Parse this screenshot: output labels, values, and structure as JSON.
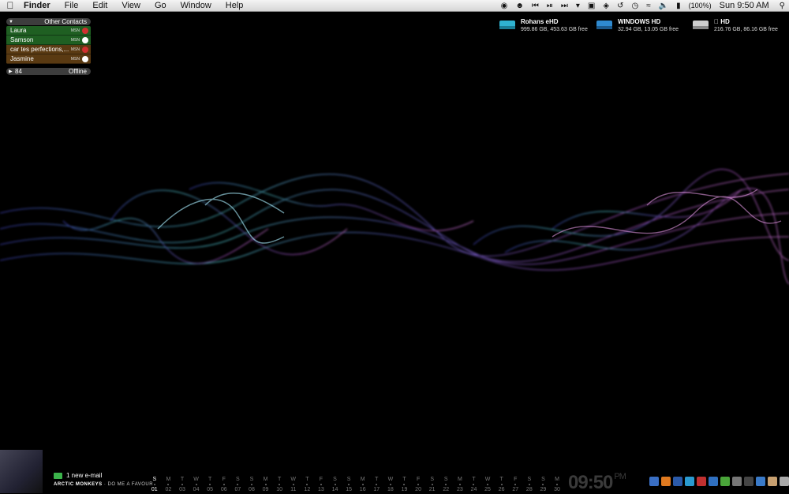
{
  "menubar": {
    "app_name": "Finder",
    "menus": [
      "File",
      "Edit",
      "View",
      "Go",
      "Window",
      "Help"
    ],
    "battery": "(100%)",
    "clock": "Sun 9:50 AM"
  },
  "contacts_widget": {
    "group_title": "Other Contacts",
    "contacts": [
      {
        "name": "Laura",
        "service": "MSN",
        "status_color": "#d03030"
      },
      {
        "name": "Samson",
        "service": "MSN",
        "status_color": "#ffffff"
      },
      {
        "name": "car tes perfections,...",
        "service": "MSN",
        "status_color": "#d03030"
      },
      {
        "name": "Jasmine",
        "service": "MSN",
        "status_color": "#ffffff"
      }
    ],
    "offline_count": "84",
    "offline_label": "Offline"
  },
  "drives": [
    {
      "name": "Rohans eHD",
      "info": "999.86 GB, 453.63 GB free",
      "color": "#2fb2d0"
    },
    {
      "name": "WINDOWS HD",
      "info": "32.94 GB, 13.05 GB free",
      "color": "#2f8ad0"
    },
    {
      "name": " HD",
      "info": "216.76 GB, 86.16 GB free",
      "color": "#c8c8c8"
    }
  ],
  "mail": {
    "text": "1 new e-mail"
  },
  "now_playing": {
    "artist": "ARCTIC MONKEYS",
    "song": "DO ME A FAVOUR"
  },
  "calendar": {
    "days": [
      "S",
      "M",
      "T",
      "W",
      "T",
      "F",
      "S",
      "S",
      "M",
      "T",
      "W",
      "T",
      "F",
      "S",
      "S",
      "M",
      "T",
      "W",
      "T",
      "F",
      "S",
      "S",
      "M",
      "T",
      "W",
      "T",
      "F",
      "S",
      "S",
      "M"
    ],
    "dates": [
      "01",
      "02",
      "03",
      "04",
      "05",
      "06",
      "07",
      "08",
      "09",
      "10",
      "11",
      "12",
      "13",
      "14",
      "15",
      "16",
      "17",
      "18",
      "19",
      "20",
      "21",
      "22",
      "23",
      "24",
      "25",
      "26",
      "27",
      "28",
      "29",
      "30"
    ],
    "today_index": 0
  },
  "big_clock": {
    "time": "09:50",
    "ampm": "PM"
  },
  "dock_colors": [
    "#3a6fc4",
    "#e07a20",
    "#2b5aa8",
    "#2a9ad0",
    "#c03030",
    "#3070c0",
    "#4aa53a",
    "#777",
    "#444",
    "#3a7ac8",
    "#c8a070",
    "#aaa"
  ]
}
